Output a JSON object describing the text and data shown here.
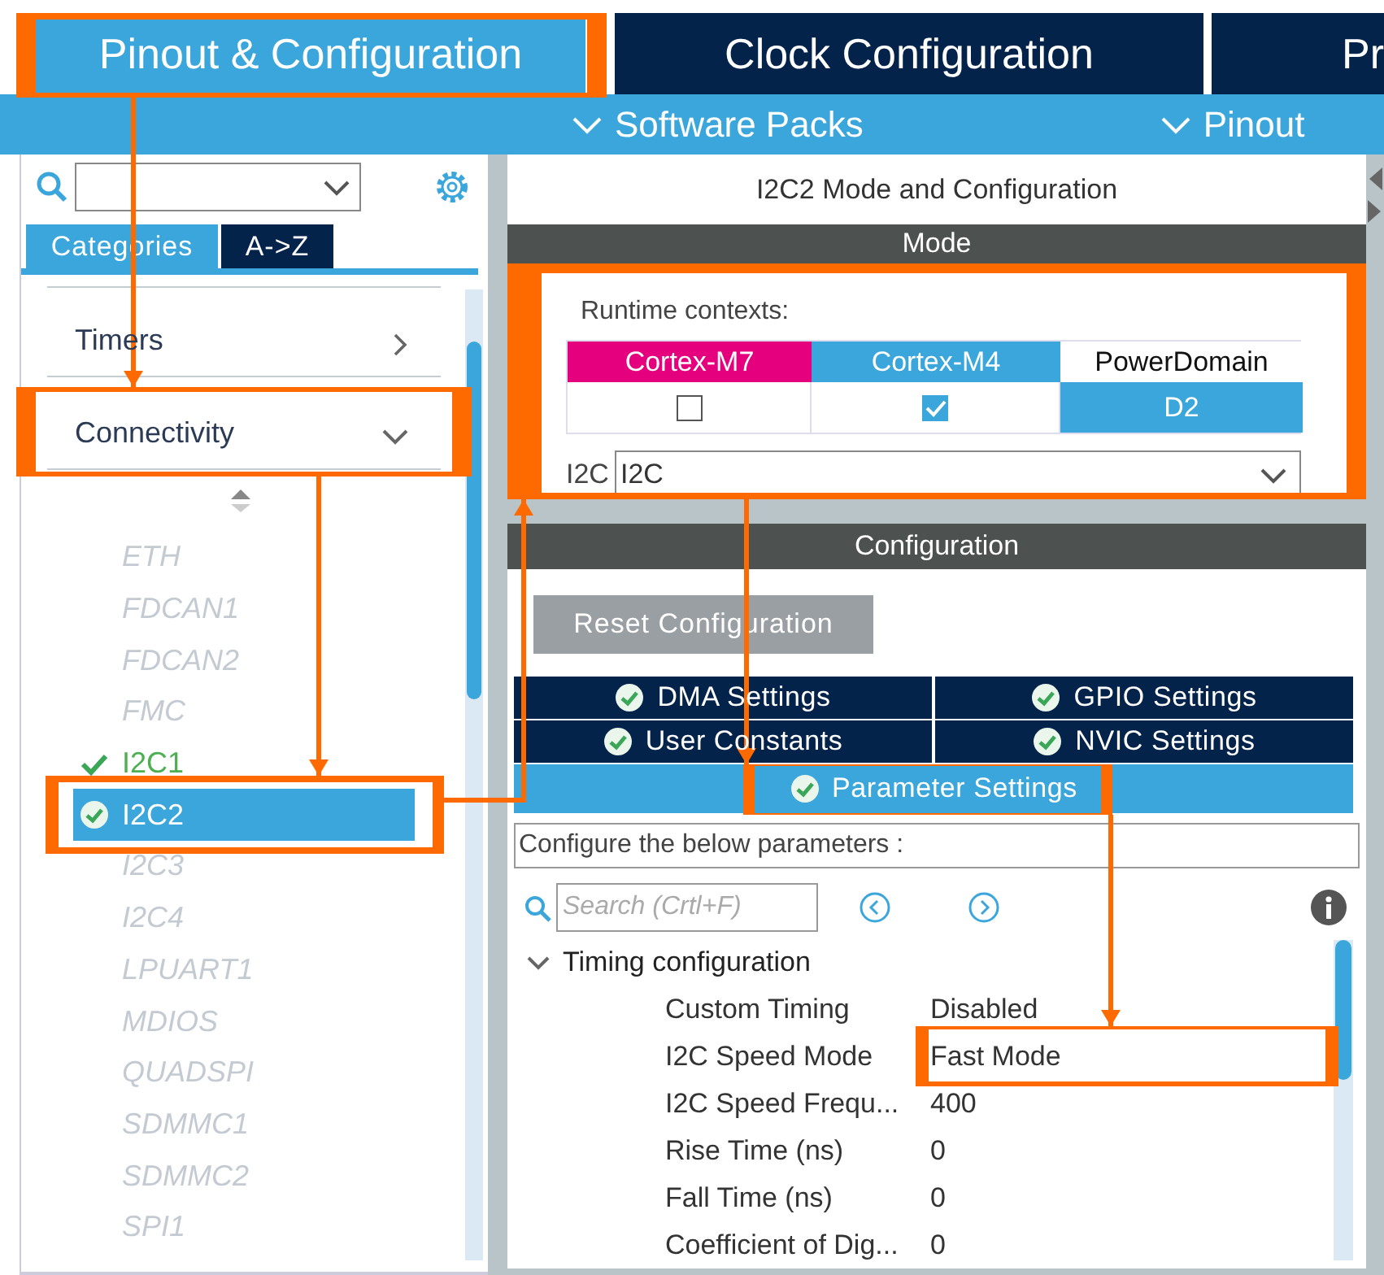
{
  "top_tabs": [
    {
      "label": "Pinout & Configuration",
      "selected": true
    },
    {
      "label": "Clock Configuration",
      "selected": false
    },
    {
      "label": "Pr",
      "selected": false
    }
  ],
  "sub_toolbar": [
    {
      "label": "Software Packs"
    },
    {
      "label": "Pinout"
    }
  ],
  "left_panel": {
    "view_tabs": [
      {
        "label": "Categories",
        "selected": true
      },
      {
        "label": "A->Z",
        "selected": false
      }
    ],
    "categories": [
      {
        "label": "Timers",
        "expanded": false
      },
      {
        "label": "Connectivity",
        "expanded": true,
        "children": [
          {
            "label": "ETH",
            "disabled": true,
            "configured": false,
            "selected": false
          },
          {
            "label": "FDCAN1",
            "disabled": true,
            "configured": false,
            "selected": false
          },
          {
            "label": "FDCAN2",
            "disabled": true,
            "configured": false,
            "selected": false
          },
          {
            "label": "FMC",
            "disabled": true,
            "configured": false,
            "selected": false
          },
          {
            "label": "I2C1",
            "disabled": false,
            "configured": true,
            "selected": false
          },
          {
            "label": "I2C2",
            "disabled": false,
            "configured": true,
            "selected": true
          },
          {
            "label": "I2C3",
            "disabled": true,
            "configured": false,
            "selected": false
          },
          {
            "label": "I2C4",
            "disabled": true,
            "configured": false,
            "selected": false
          },
          {
            "label": "LPUART1",
            "disabled": true,
            "configured": false,
            "selected": false
          },
          {
            "label": "MDIOS",
            "disabled": true,
            "configured": false,
            "selected": false
          },
          {
            "label": "QUADSPI",
            "disabled": true,
            "configured": false,
            "selected": false
          },
          {
            "label": "SDMMC1",
            "disabled": true,
            "configured": false,
            "selected": false
          },
          {
            "label": "SDMMC2",
            "disabled": true,
            "configured": false,
            "selected": false
          },
          {
            "label": "SPI1",
            "disabled": true,
            "configured": false,
            "selected": false
          }
        ]
      }
    ]
  },
  "right_panel": {
    "title": "I2C2 Mode and Configuration",
    "mode": {
      "header": "Mode",
      "runtime_label": "Runtime contexts:",
      "contexts": [
        {
          "name": "Cortex-M7",
          "color": "#e5007e",
          "checked": false
        },
        {
          "name": "Cortex-M4",
          "color": "#3ba6dc",
          "checked": true
        }
      ],
      "power_domain": {
        "header": "PowerDomain",
        "value": "D2"
      },
      "field": {
        "label": "I2C",
        "value": "I2C"
      }
    },
    "configuration": {
      "header": "Configuration",
      "reset_button": "Reset Configuration",
      "tab_rows": [
        [
          {
            "label": "DMA Settings",
            "selected": false
          },
          {
            "label": "GPIO Settings",
            "selected": false
          }
        ],
        [
          {
            "label": "User Constants",
            "selected": false
          },
          {
            "label": "NVIC Settings",
            "selected": false
          }
        ],
        [
          {
            "label": "Parameter Settings",
            "selected": true
          }
        ]
      ],
      "hint": "Configure the below parameters :",
      "search": {
        "placeholder": "Search (Crtl+F)"
      },
      "groups": [
        {
          "label": "Timing configuration",
          "expanded": true,
          "children": [
            {
              "name": "Custom Timing",
              "value": "Disabled"
            },
            {
              "name": "I2C Speed Mode",
              "value": "Fast Mode"
            },
            {
              "name": "I2C Speed Frequ...",
              "value": "400"
            },
            {
              "name": "Rise Time (ns)",
              "value": "0"
            },
            {
              "name": "Fall Time (ns)",
              "value": "0"
            },
            {
              "name": "Coefficient of Dig...",
              "value": "0"
            }
          ]
        }
      ]
    }
  }
}
